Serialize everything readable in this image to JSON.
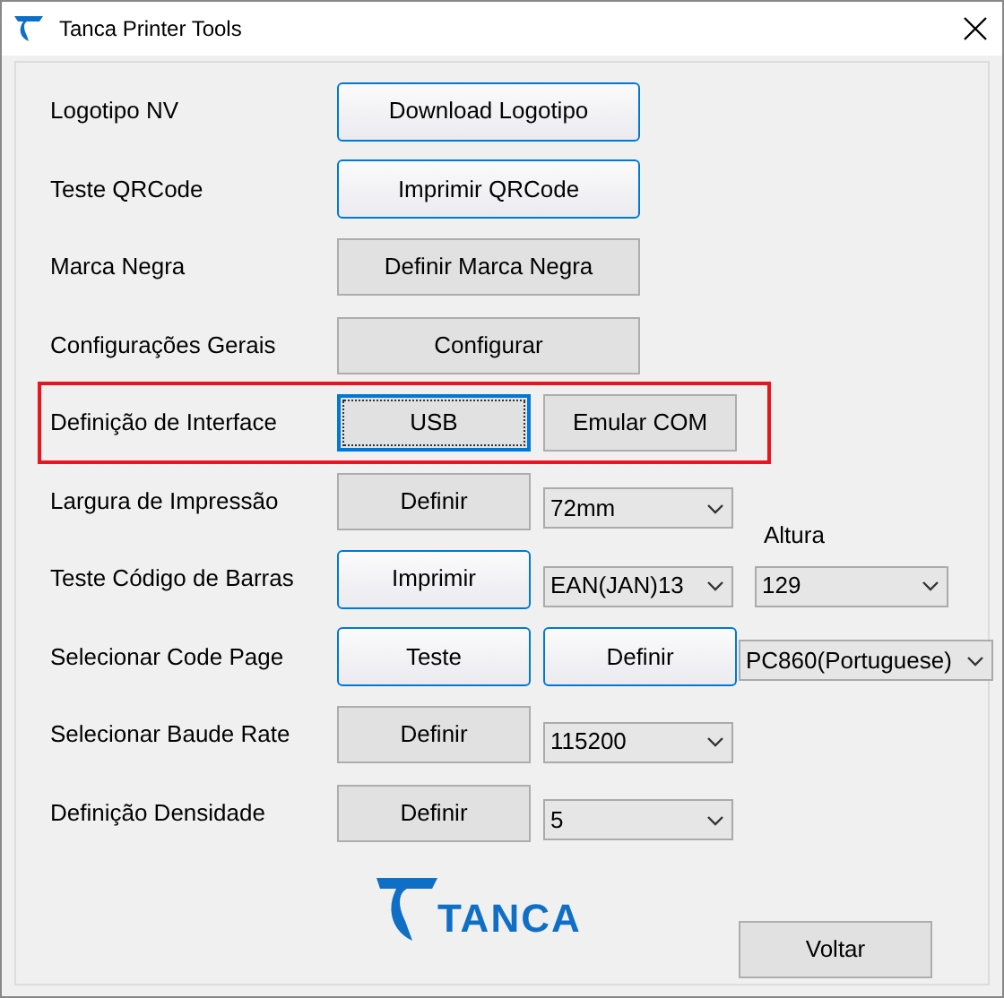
{
  "window": {
    "title": "Tanca Printer Tools"
  },
  "rows": [
    {
      "label": "Logotipo NV",
      "outlined": false,
      "buttons": [
        {
          "text": "Download Logotipo",
          "wide": true,
          "highlighted": true,
          "focused": false
        }
      ],
      "dropdowns": []
    },
    {
      "label": "Teste QRCode",
      "outlined": false,
      "buttons": [
        {
          "text": "Imprimir QRCode",
          "wide": true,
          "highlighted": true,
          "focused": false
        }
      ],
      "dropdowns": []
    },
    {
      "label": "Marca Negra",
      "outlined": false,
      "buttons": [
        {
          "text": "Definir Marca Negra",
          "wide": true,
          "highlighted": false,
          "focused": false
        }
      ],
      "dropdowns": []
    },
    {
      "label": "Configurações Gerais",
      "outlined": false,
      "buttons": [
        {
          "text": "Configurar",
          "wide": true,
          "highlighted": false,
          "focused": false
        }
      ],
      "dropdowns": []
    },
    {
      "label": "Definição de Interface",
      "outlined": true,
      "buttons": [
        {
          "text": "USB",
          "wide": false,
          "highlighted": false,
          "focused": true
        },
        {
          "text": "Emular COM",
          "wide": false,
          "highlighted": false,
          "focused": false
        }
      ],
      "dropdowns": []
    },
    {
      "label": "Largura de Impressão",
      "outlined": false,
      "buttons": [
        {
          "text": "Definir",
          "wide": false,
          "highlighted": false,
          "focused": false
        }
      ],
      "dropdowns": [
        {
          "value": "72mm"
        }
      ]
    },
    {
      "label": "Teste Código de Barras",
      "outlined": false,
      "buttons": [
        {
          "text": "Imprimir",
          "wide": false,
          "highlighted": true,
          "focused": false
        }
      ],
      "dropdowns": [
        {
          "value": "EAN(JAN)13"
        },
        {
          "value": "129",
          "caption": "Altura"
        }
      ]
    },
    {
      "label": "Selecionar Code Page",
      "outlined": false,
      "buttons": [
        {
          "text": "Teste",
          "wide": false,
          "highlighted": true,
          "focused": false
        },
        {
          "text": "Definir",
          "wide": false,
          "highlighted": true,
          "focused": false
        }
      ],
      "dropdowns": [
        {
          "value": "PC860(Portuguese)"
        }
      ]
    },
    {
      "label": "Selecionar Baude Rate",
      "outlined": false,
      "buttons": [
        {
          "text": "Definir",
          "wide": false,
          "highlighted": false,
          "focused": false
        }
      ],
      "dropdowns": [
        {
          "value": "115200"
        }
      ]
    },
    {
      "label": "Definição Densidade",
      "outlined": false,
      "buttons": [
        {
          "text": "Definir",
          "wide": false,
          "highlighted": false,
          "focused": false
        }
      ],
      "dropdowns": [
        {
          "value": "5"
        }
      ]
    }
  ],
  "logo": {
    "text": "TANCA"
  },
  "footer_button": {
    "text": "Voltar"
  }
}
